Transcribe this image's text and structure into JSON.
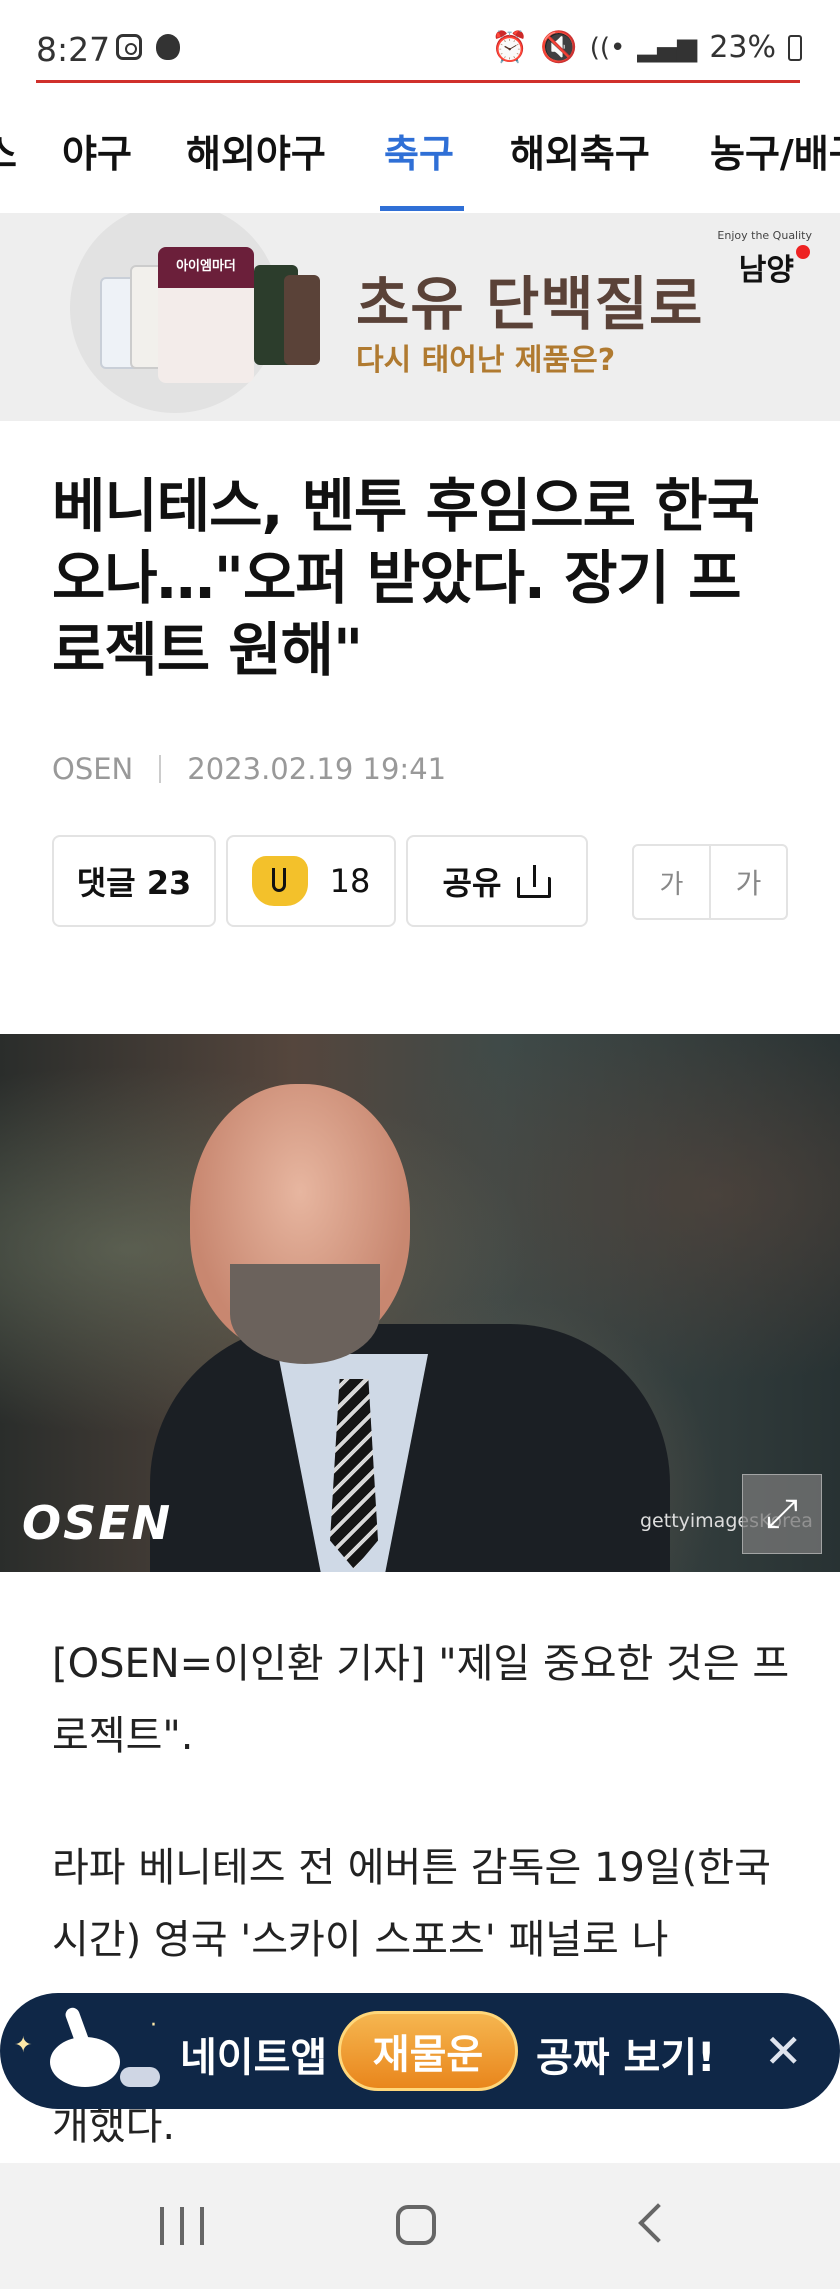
{
  "status": {
    "time": "8:27",
    "battery": "23%"
  },
  "tabs": [
    {
      "label": "스"
    },
    {
      "label": "야구"
    },
    {
      "label": "해외야구"
    },
    {
      "label": "축구"
    },
    {
      "label": "해외축구"
    },
    {
      "label": "농구/배구"
    }
  ],
  "active_tab_index": 3,
  "ad_banner": {
    "headline": "초유 단백질로",
    "subline": "다시 태어난 제품은?",
    "brand_small": "Enjoy the Quality",
    "brand": "남양",
    "product_label": "아이엠마더"
  },
  "article": {
    "title": "베니테스, 벤투 후임으로 한국 오나…\"오퍼 받았다. 장기 프로젝트 원해\"",
    "source": "OSEN",
    "datetime": "2023.02.19 19:41",
    "photo_logo": "OSEN",
    "photo_credit": "gettyimagesKorea",
    "paragraphs": [
      "[OSEN=이인환 기자] \"제일 중요한 것은 프로젝트\".",
      "라파 베니테즈 전 에버튼 감독은 19일(한국시간) 영국 '스카이 스포츠' 패널로 나",
      "개했다."
    ]
  },
  "actions": {
    "comment_label": "댓글 23",
    "like_count": "18",
    "share_label": "공유",
    "font_small": "가",
    "font_large": "가"
  },
  "promo": {
    "left_text": "네이트앱",
    "pill_text": "재물운",
    "right_text": "공짜 보기!"
  },
  "colors": {
    "accent_blue": "#2f6fd6",
    "promo_bg": "#0f2747",
    "like_yellow": "#f3c12b"
  }
}
